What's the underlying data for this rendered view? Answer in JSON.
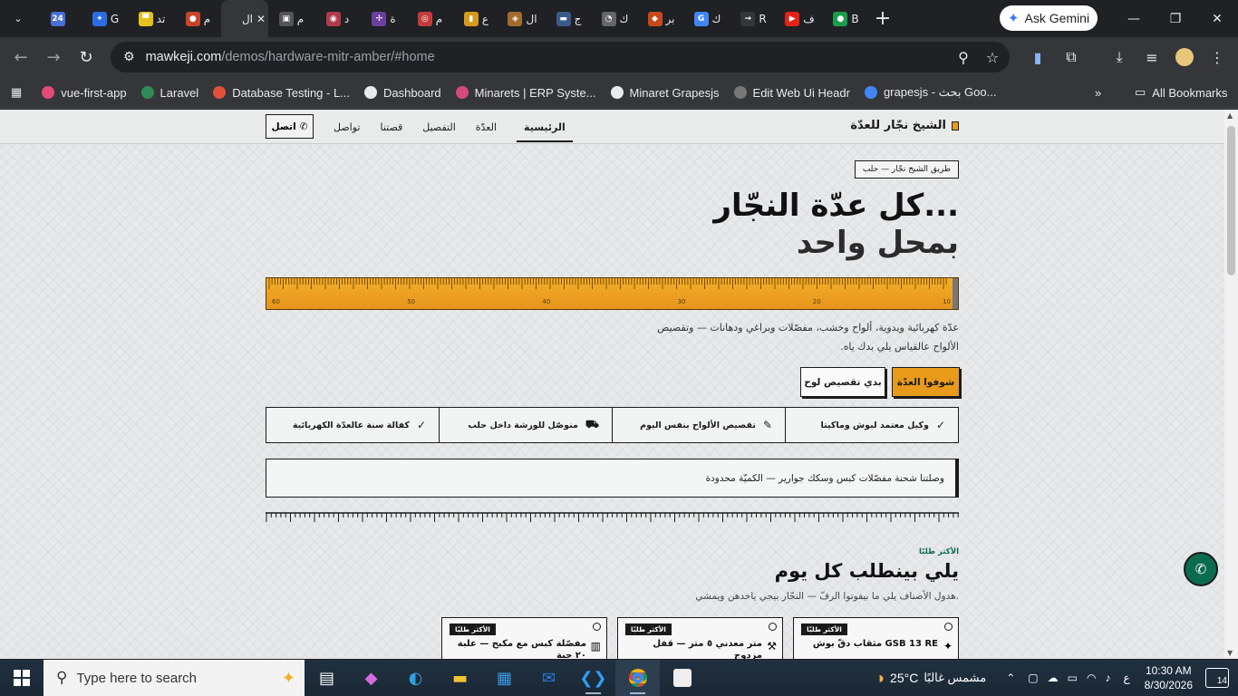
{
  "browser": {
    "tabs": [
      {
        "icon_text": "24",
        "color": "#4a6fd6",
        "label": ""
      },
      {
        "icon_text": "✦",
        "color": "#2b6de3",
        "label": "G"
      },
      {
        "icon_text": "▀",
        "color": "#e8c21b",
        "label": "تد"
      },
      {
        "icon_text": "●",
        "color": "#c8452c",
        "label": "م"
      },
      {
        "icon_text": "",
        "color": "#35363a",
        "label": "ال",
        "active": true
      },
      {
        "icon_text": "▣",
        "color": "#555",
        "label": "م"
      },
      {
        "icon_text": "◉",
        "color": "#b03a4a",
        "label": "د"
      },
      {
        "icon_text": "✢",
        "color": "#6b3fa0",
        "label": "ة"
      },
      {
        "icon_text": "◎",
        "color": "#c43b3b",
        "label": "م"
      },
      {
        "icon_text": "▮",
        "color": "#d89a1b",
        "label": "ع"
      },
      {
        "icon_text": "◈",
        "color": "#a36b2e",
        "label": "ال"
      },
      {
        "icon_text": "▬",
        "color": "#3a5a8a",
        "label": "ج"
      },
      {
        "icon_text": "◔",
        "color": "#666",
        "label": "ك"
      },
      {
        "icon_text": "◆",
        "color": "#c84a1b",
        "label": "بر"
      },
      {
        "icon_text": "G",
        "color": "#4285f4",
        "label": "ك"
      },
      {
        "icon_text": "→",
        "color": "#35363a",
        "label": "R"
      },
      {
        "icon_text": "▶",
        "color": "#e62117",
        "label": "ف"
      },
      {
        "icon_text": "●",
        "color": "#1a9e4a",
        "label": "B"
      }
    ],
    "gemini_label": "Ask Gemini",
    "url_host": "mawkeji.com",
    "url_path": "/demos/hardware-mitr-amber/#home",
    "bookmarks": [
      {
        "label": "vue-first-app",
        "color": "#e24a7a"
      },
      {
        "label": "Laravel",
        "color": "#2e8b57"
      },
      {
        "label": "Database Testing - L...",
        "color": "#e2503a"
      },
      {
        "label": "Dashboard",
        "color": "#e8eaed"
      },
      {
        "label": "Minarets | ERP Syste...",
        "color": "#d44a7a"
      },
      {
        "label": "Minaret Grapesjs",
        "color": "#e8eaed"
      },
      {
        "label": "Edit Web Ui Headr",
        "color": "#777"
      },
      {
        "label": "grapesjs - بحث Goo...",
        "color": "#4285f4"
      }
    ],
    "all_bookmarks": "All Bookmarks"
  },
  "site": {
    "brand": "الشيخ نجّار للعدّة",
    "nav": [
      "الرئيسية",
      "العدّة",
      "التفصيل",
      "قصتنا",
      "تواصل"
    ],
    "call": "اتصل",
    "hero_tag": "طريق الشيخ نجّار — حلب",
    "hero_line1": "كل عدّة النجّار...",
    "hero_line2": "بمحل واحد",
    "ruler_labels": [
      "60",
      "50",
      "40",
      "30",
      "20",
      "10"
    ],
    "hero_desc": "عدّة كهربائية ويدوية، ألواح وخشب، مفصّلات وبراغي ودهانات — وتقصيص الألواح عالقياس يلي بدك ياه.",
    "btn_primary": "شوفوا العدّة",
    "btn_secondary": "بدي تقصيص لوح",
    "features": [
      {
        "text": "وكيل معتمد لبوش وماكيتا",
        "icon": "✓"
      },
      {
        "text": "تقصيص الألواح بنفس اليوم",
        "icon": "✎"
      },
      {
        "text": "منوصّل للورشة داخل حلب",
        "icon": "⛟"
      },
      {
        "text": "كفالة سنة عالعدّة الكهربائية",
        "icon": "✓"
      }
    ],
    "notice": "وصلتنا شحنة مفصّلات كبس وسكك جوارير — الكميّة محدودة",
    "section_kicker": "الأكثر طلبًا",
    "section_title": "يلي بينطلب كل يوم",
    "section_sub": "هدول الأصناف يلي ما بيفوتوا الرفّ — النجّار بيجي ياخدهن ويمشي.",
    "cards": [
      {
        "badge": "الأكثر طلبًا",
        "title": "مثقاب دقّ بوش GSB 13 RE",
        "icon": "🔧"
      },
      {
        "badge": "الأكثر طلبًا",
        "title": "متر معدني ٥ متر — قفل مزدوج",
        "icon": "📏"
      },
      {
        "badge": "الأكثر طلبًا",
        "title": "مفصّلة كبس مع مكبح — علبة ٢٠ حبة",
        "icon": "▥"
      }
    ]
  },
  "taskbar": {
    "search_placeholder": "Type here to search",
    "weather": "25°C",
    "weather_text": "مشمس غالبًا",
    "lang": "ع",
    "time": "10:30 AM",
    "date": "8/30/2026",
    "notif_count": "14"
  }
}
